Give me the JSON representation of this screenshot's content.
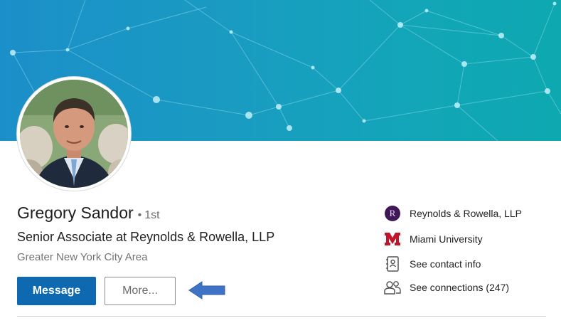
{
  "profile": {
    "name": "Gregory Sandor",
    "degree_dot": "•",
    "degree": "1st",
    "headline": "Senior Associate at Reynolds & Rowella, LLP",
    "location": "Greater New York City Area"
  },
  "actions": {
    "message_label": "Message",
    "more_label": "More..."
  },
  "sidebar": {
    "items": [
      {
        "label": "Reynolds & Rowella, LLP",
        "icon": "company-logo-icon",
        "logo_letter": "R"
      },
      {
        "label": "Miami University",
        "icon": "university-logo-icon"
      },
      {
        "label": "See contact info",
        "icon": "contact-card-icon"
      },
      {
        "label": "See connections (247)",
        "icon": "people-icon"
      }
    ]
  },
  "colors": {
    "banner_start": "#1b8fc9",
    "banner_end": "#0ea8b0",
    "primary_button": "#0e69b0",
    "arrow": "#3f73c6",
    "miami_red": "#c3142d",
    "company_logo": "#40185a"
  }
}
